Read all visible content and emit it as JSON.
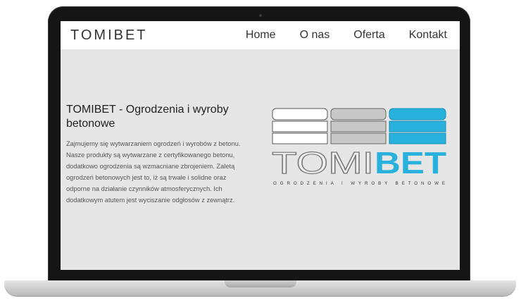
{
  "brand": "TOMIBET",
  "nav": {
    "home": "Home",
    "about": "O nas",
    "offer": "Oferta",
    "contact": "Kontakt"
  },
  "hero": {
    "title": "TOMIBET - Ogrodzenia i wyroby betonowe",
    "text": "Zajmujemy się wytwarzaniem ogrodzeń i wyrobów z betonu. Nasze produkty są wytwarzane z certyfikowanego betonu, dodatkowo ogrodzenia są wzmacniane zbrojeniem. Zaletą ogrodzeń betonowych jest to, iż są trwałe i solidne oraz odporne na działanie czynników atmosferycznych. Ich dodatkowym atutem jest wyciszanie odgłosów z zewnątrz."
  },
  "logo": {
    "part1": "TOMI",
    "part2": "BET",
    "tagline": "OGRODZENIA I WYROBY BETONOWE"
  },
  "colors": {
    "accent": "#29b1de",
    "panel_white": "#ffffff",
    "panel_grey": "#c8c8c8",
    "screen_bg": "#e6e6e6"
  }
}
